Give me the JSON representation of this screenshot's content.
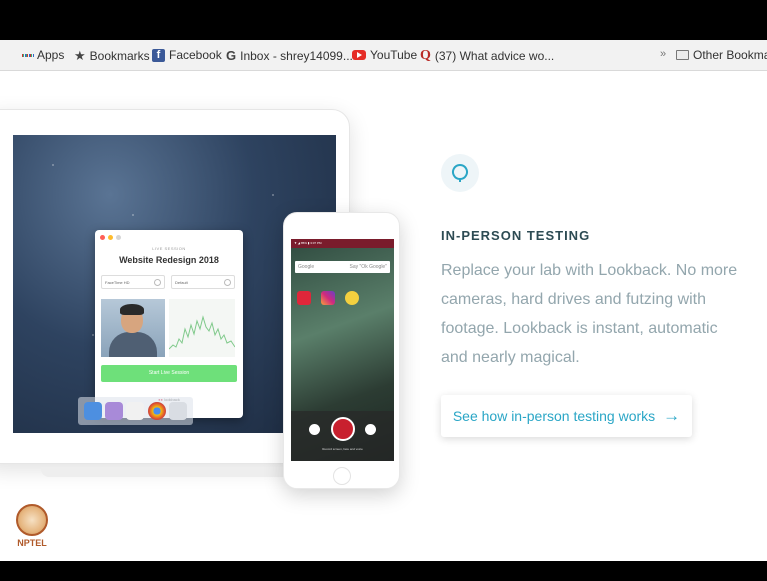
{
  "bookmarks": {
    "apps": "Apps",
    "bookmarks": "Bookmarks",
    "facebook": "Facebook",
    "inbox": "Inbox - shrey14099...",
    "youtube": "YouTube",
    "quora": "(37) What advice wo...",
    "overflow": "»",
    "other": "Other Bookmarks"
  },
  "app_window": {
    "live_label": "LIVE SESSION",
    "title": "Website Redesign 2018",
    "camera_select": "FaceTime HD",
    "audio_select": "Default",
    "start_button": "Start Live Session",
    "brand": "lookback"
  },
  "phone": {
    "status": "▼ ◢ 85% ▮ 3:07 PM",
    "search_placeholder": "Google",
    "search_hint": "Say \"Ok Google\"",
    "record_caption": "Record screen, face and voice"
  },
  "feature": {
    "icon": "speech-bubble-icon",
    "heading": "IN-PERSON TESTING",
    "description": "Replace your lab with Lookback. No more cameras, hard drives and futzing with footage. Lookback is instant, automatic and nearly magical.",
    "cta_label": "See how in-person testing works",
    "cta_arrow": "→"
  },
  "watermark": {
    "text": "NPTEL"
  },
  "colors": {
    "accent": "#2aa6c6",
    "heading": "#2d4b53",
    "body_text": "#93a6ad",
    "start_button": "#6ee07a",
    "record": "#c8202e"
  }
}
